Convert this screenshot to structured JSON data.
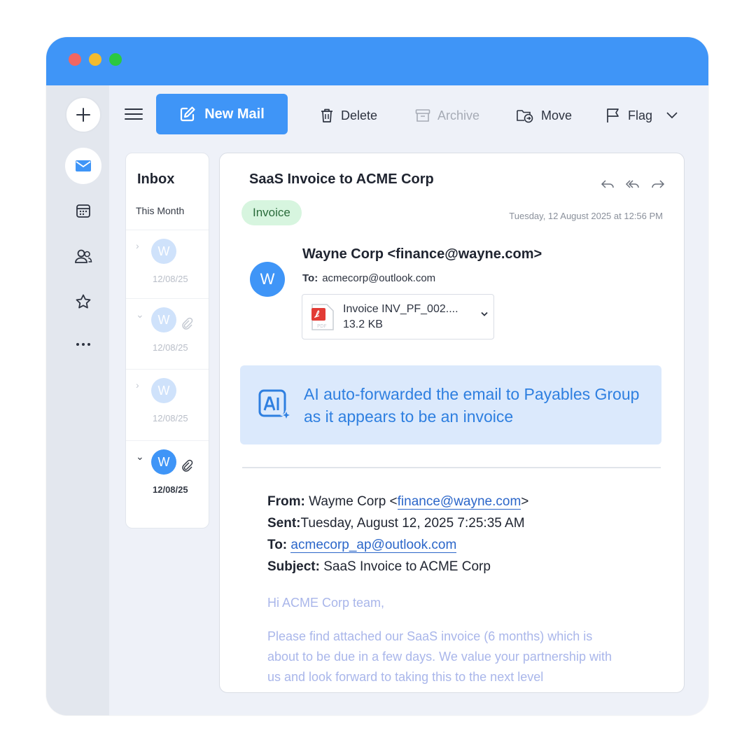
{
  "toolbar": {
    "new_mail": "New Mail",
    "delete": "Delete",
    "archive": "Archive",
    "move": "Move",
    "flag": "Flag"
  },
  "list": {
    "title": "Inbox",
    "section": "This Month",
    "items": [
      {
        "initial": "W",
        "date": "12/08/25",
        "attachment": false,
        "expanded": false
      },
      {
        "initial": "W",
        "date": "12/08/25",
        "attachment": true,
        "expanded": true
      },
      {
        "initial": "W",
        "date": "12/08/25",
        "attachment": false,
        "expanded": false
      },
      {
        "initial": "W",
        "date": "12/08/25",
        "attachment": true,
        "expanded": true
      }
    ]
  },
  "email": {
    "subject": "SaaS Invoice to ACME Corp",
    "tag": "Invoice",
    "timestamp": "Tuesday, 12 August 2025 at 12:56 PM",
    "sender_initial": "W",
    "sender": "Wayne Corp <finance@wayne.com>",
    "to_label": "To:",
    "to": "acmecorp@outlook.com",
    "attachment": {
      "name": "Invoice INV_PF_002....",
      "size": "13.2 KB"
    },
    "ai_notice": "AI auto-forwarded the email to Payables Group as it appears to be an invoice",
    "forwarded": {
      "from_label": "From:",
      "from_name": "Wayme Corp <",
      "from_email": "finance@wayne.com",
      "from_close": ">",
      "sent_label": "Sent:",
      "sent": "Tuesday, August 12, 2025 7:25:35 AM",
      "to_label": "To:",
      "to": "acmecorp_ap@outlook.com",
      "subject_label": "Subject:",
      "subject": "SaaS Invoice to ACME Corp"
    },
    "greeting": "Hi ACME Corp team,",
    "body_lines": [
      "Please find attached our SaaS invoice (6 months) which is",
      "about to be due in a few days. We value your partnership with",
      "us and look forward to taking this to the next level"
    ]
  },
  "colors": {
    "accent": "#3f95f7",
    "tag_bg": "#d7f5df",
    "ai_bg": "#dbe9fc",
    "ai_text": "#2e7fe0"
  }
}
